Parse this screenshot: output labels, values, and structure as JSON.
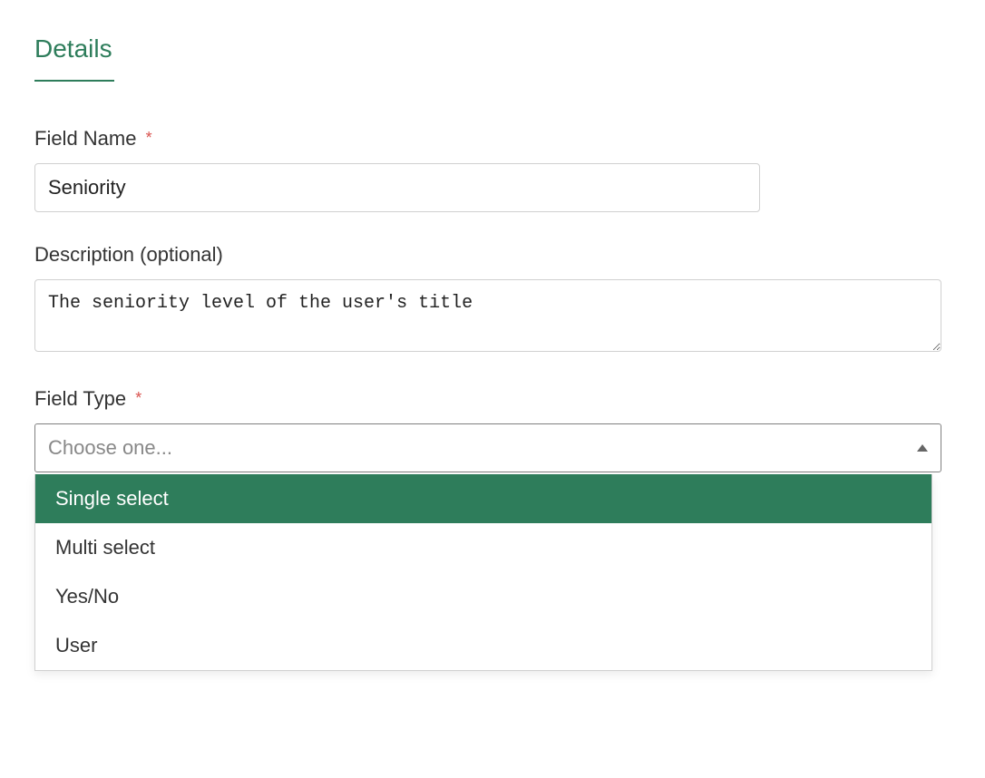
{
  "section": {
    "title": "Details"
  },
  "form": {
    "fieldName": {
      "label": "Field Name",
      "required": "*",
      "value": "Seniority"
    },
    "description": {
      "label": "Description (optional)",
      "value": "The seniority level of the user's title"
    },
    "fieldType": {
      "label": "Field Type",
      "required": "*",
      "placeholder": "Choose one...",
      "options": [
        {
          "label": "Single select",
          "highlighted": true
        },
        {
          "label": "Multi select",
          "highlighted": false
        },
        {
          "label": "Yes/No",
          "highlighted": false
        },
        {
          "label": "User",
          "highlighted": false
        }
      ]
    }
  }
}
